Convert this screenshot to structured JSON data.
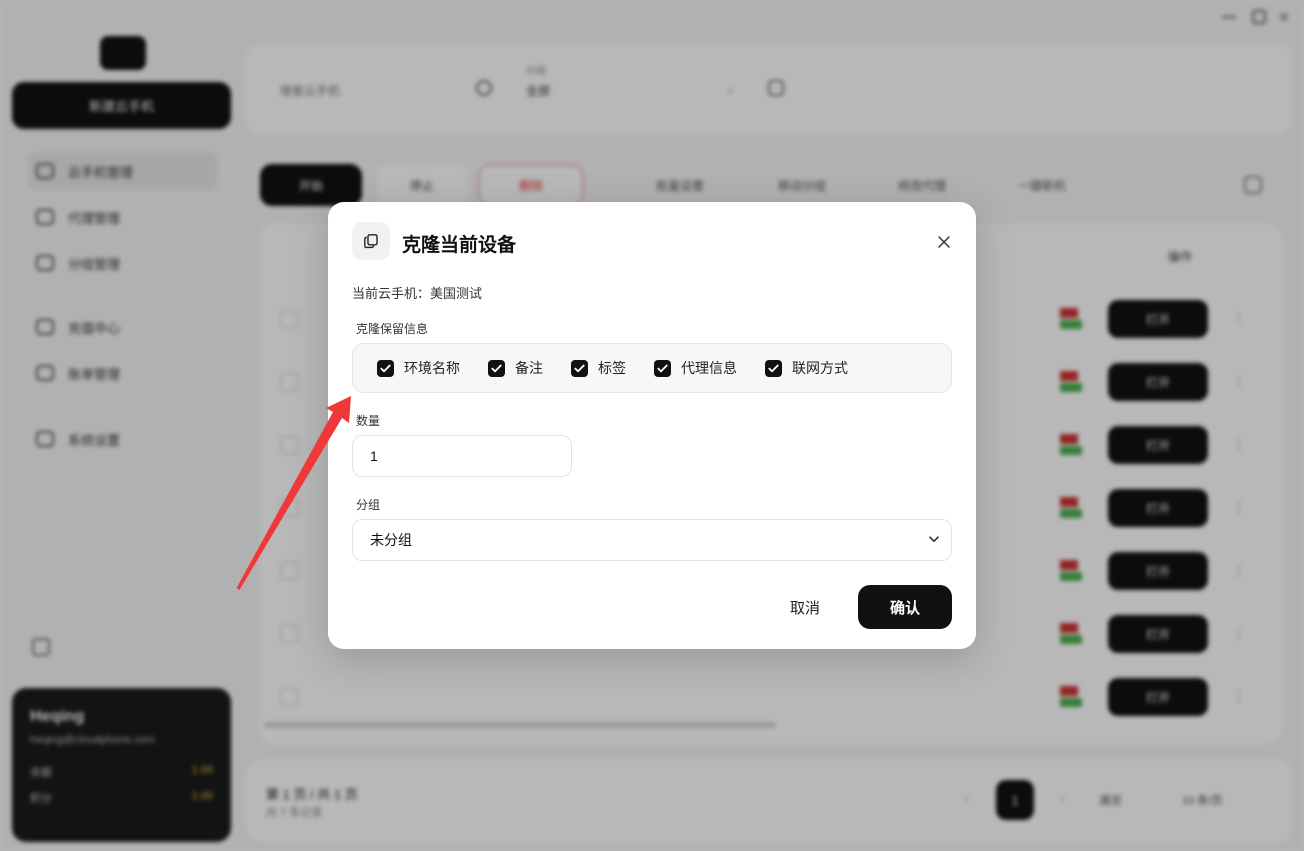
{
  "background": {
    "sidebar": {
      "new_button": "新建云手机",
      "nav": [
        "云手机管理",
        "代理管理",
        "分组管理",
        "充值中心",
        "账单管理",
        "系统设置"
      ],
      "user": {
        "name": "Heqing",
        "email": "heqing@cloudphone.com",
        "row1_label": "余额",
        "row1_value": "1.00",
        "row2_label": "积分",
        "row2_value": "1.00"
      }
    },
    "filters": {
      "search_placeholder": "搜索云手机",
      "group_label": "分组",
      "group_value": "全部"
    },
    "toolbar": {
      "start": "开始",
      "stop": "停止",
      "delete": "删除",
      "b4": "批量设置",
      "b5": "移动分组",
      "b6": "修改代理",
      "b7": "一键新机"
    },
    "table": {
      "op_header": "操作",
      "open_label": "打开",
      "row_count": 7
    },
    "pagination": {
      "info": "第 1 页 / 共 1 页",
      "sub": "共 7 条记录",
      "current": "1",
      "jump": "跳至",
      "size": "10 条/页"
    }
  },
  "modal": {
    "title": "克隆当前设备",
    "current_label": "当前云手机：",
    "current_value": "美国测试",
    "keep_section": "克隆保留信息",
    "options": [
      {
        "label": "环境名称",
        "checked": true
      },
      {
        "label": "备注",
        "checked": true
      },
      {
        "label": "标签",
        "checked": true
      },
      {
        "label": "代理信息",
        "checked": true
      },
      {
        "label": "联网方式",
        "checked": true
      }
    ],
    "quantity_label": "数量",
    "quantity_value": "1",
    "group_label": "分组",
    "group_value": "未分组",
    "cancel": "取消",
    "confirm": "确认"
  },
  "annotation": {
    "arrow_color": "#f0383a"
  }
}
